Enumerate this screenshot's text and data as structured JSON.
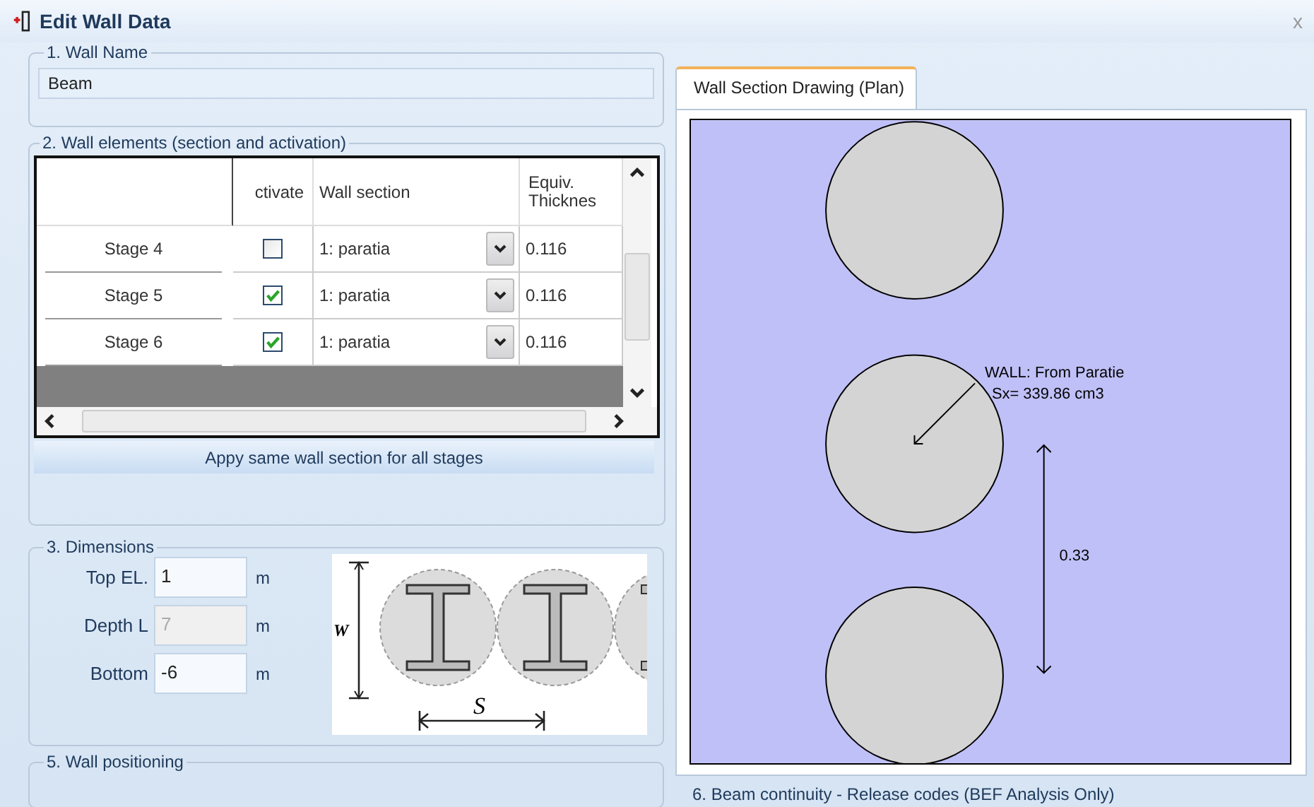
{
  "window": {
    "title": "Edit Wall Data",
    "close": "x"
  },
  "wall_name": {
    "legend": "1. Wall Name",
    "value": "Beam"
  },
  "wall_elements": {
    "legend": "2. Wall elements (section and activation)",
    "columns": [
      "ctivate",
      "Wall section",
      "Equiv. Thicknes"
    ],
    "rows": [
      {
        "stage": "Stage 4",
        "activate": false,
        "section": "1: paratia",
        "thickness": "0.116"
      },
      {
        "stage": "Stage 5",
        "activate": true,
        "section": "1: paratia",
        "thickness": "0.116"
      },
      {
        "stage": "Stage 6",
        "activate": true,
        "section": "1: paratia",
        "thickness": "0.116"
      }
    ],
    "apply_button": "Appy same wall section for all stages"
  },
  "dimensions": {
    "legend": "3. Dimensions",
    "fields": [
      {
        "label": "Top EL.",
        "value": "1",
        "unit": "m",
        "disabled": false
      },
      {
        "label": "Depth L",
        "value": "7",
        "unit": "m",
        "disabled": true
      },
      {
        "label": "Bottom",
        "value": "-6",
        "unit": "m",
        "disabled": false
      }
    ],
    "diagram": {
      "width_label": "W",
      "spacing_label": "S"
    }
  },
  "wall_positioning": {
    "legend": "5. Wall positioning"
  },
  "drawing": {
    "tabs": [
      {
        "label": "Wall Section Drawing (Plan)",
        "selected": true
      }
    ],
    "annotation": [
      "WALL: From Paratie",
      "Sx= 339.86 cm3"
    ],
    "dimension": "0.33"
  },
  "beam_continuity": {
    "legend": "6. Beam continuity - Release codes (BEF Analysis Only)"
  }
}
